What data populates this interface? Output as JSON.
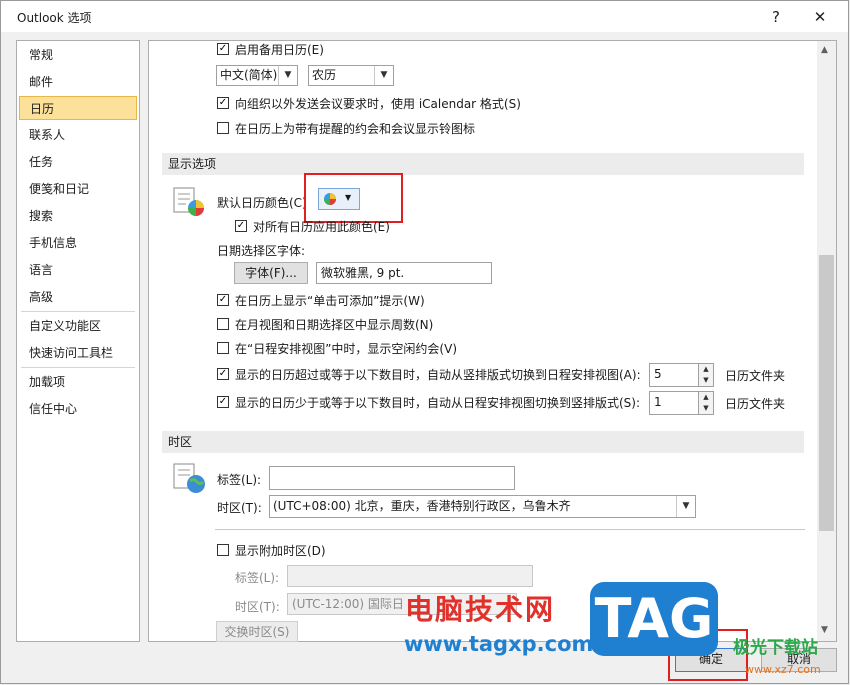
{
  "window": {
    "title": "Outlook 选项",
    "help": "?",
    "close": "✕"
  },
  "nav": {
    "items": [
      "常规",
      "邮件",
      "日历",
      "联系人",
      "任务",
      "便笺和日记",
      "搜索",
      "手机信息",
      "语言",
      "高级",
      "自定义功能区",
      "快速访问工具栏",
      "加载项",
      "信任中心"
    ],
    "selected": "日历"
  },
  "top": {
    "enable_alt_calendar": "启用备用日历(E)",
    "lang_select": "中文(简体)",
    "calendar_type_select": "农历",
    "icalendar": "向组织以外发送会议要求时，使用 iCalendar 格式(S)",
    "bell_icon": "在日历上为带有提醒的约会和会议显示铃图标"
  },
  "display": {
    "section_title": "显示选项",
    "default_color_label": "默认日历颜色(C)",
    "apply_all": "对所有日历应用此颜色(E)",
    "date_font_label": "日期选择区字体:",
    "font_button": "字体(F)...",
    "font_value": "微软雅黑, 9 pt.",
    "click_to_add": "在日历上显示“单击可添加”提示(W)",
    "week_numbers": "在月视图和日期选择区中显示周数(N)",
    "free_appointments": "在“日程安排视图”中时，显示空闲约会(V)",
    "switch_to_schedule": "显示的日历超过或等于以下数目时，自动从竖排版式切换到日程安排视图(A):",
    "switch_to_schedule_value": "5",
    "switch_to_vertical": "显示的日历少于或等于以下数目时，自动从日程安排视图切换到竖排版式(S):",
    "switch_to_vertical_value": "1",
    "folder_suffix": "日历文件夹"
  },
  "timezone": {
    "section_title": "时区",
    "label_label": "标签(L):",
    "label_value": "",
    "zone_label": "时区(T):",
    "zone_value": "(UTC+08:00) 北京，重庆，香港特别行政区，乌鲁木齐",
    "show_additional": "显示附加时区(D)",
    "label2_label": "标签(L):",
    "zone2_label": "时区(T):",
    "zone2_value": "(UTC-12:00) 国际日",
    "swap_button": "交换时区(S)"
  },
  "footer": {
    "ok": "确定",
    "cancel": "取消"
  },
  "watermark": {
    "brand_text": "电脑技术网",
    "url": "www.tagxp.com",
    "tag": "TAG",
    "site_cn": "极光下载站",
    "site_url": "www.xz7.com"
  },
  "colors": {
    "accent_red": "#e02020",
    "nav_selected": "#fbe19a",
    "wm_red": "#e0312b",
    "wm_blue": "#1f7fd0"
  }
}
